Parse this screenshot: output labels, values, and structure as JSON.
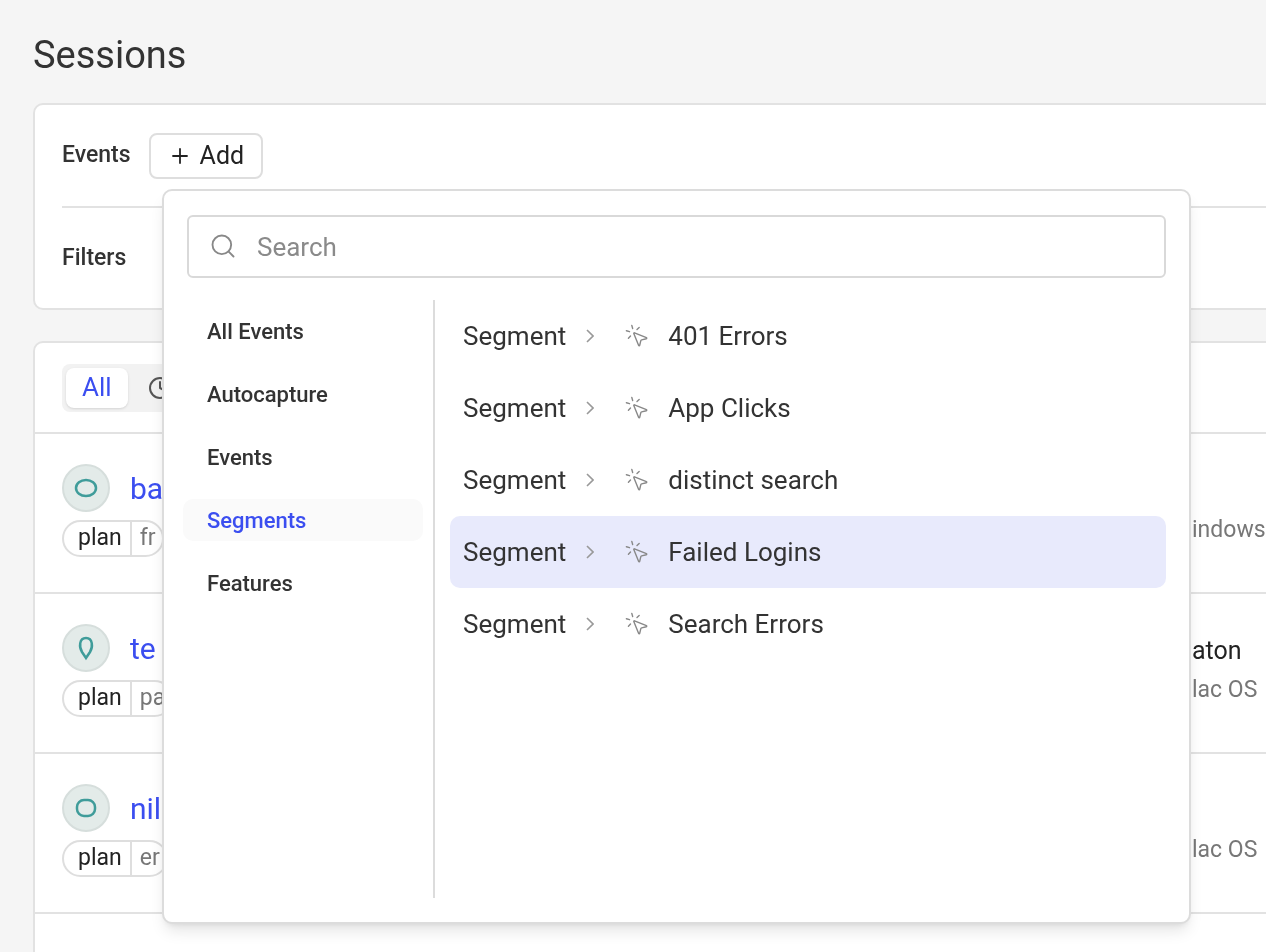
{
  "page": {
    "title": "Sessions"
  },
  "query_card": {
    "events_label": "Events",
    "add_button": "Add",
    "filters_label": "Filters"
  },
  "sessions": {
    "tabs": [
      {
        "label": "All",
        "selected": true
      },
      {
        "kind": "icon",
        "selected": false
      }
    ],
    "rows": [
      {
        "name": "ba",
        "tag_key": "plan",
        "tag_value": "fr",
        "os": "indows"
      },
      {
        "name": "te",
        "tag_key": "plan",
        "tag_value": "pa",
        "detail": "aton",
        "os": "lac OS"
      },
      {
        "name": "nil",
        "tag_key": "plan",
        "tag_value": "er",
        "os": "lac OS"
      }
    ]
  },
  "event_picker": {
    "search": {
      "placeholder": "Search"
    },
    "categories": [
      {
        "label": "All Events",
        "selected": false
      },
      {
        "label": "Autocapture",
        "selected": false
      },
      {
        "label": "Events",
        "selected": false
      },
      {
        "label": "Segments",
        "selected": true
      },
      {
        "label": "Features",
        "selected": false
      }
    ],
    "results": [
      {
        "category": "Segment",
        "name": "401 Errors",
        "selected": false
      },
      {
        "category": "Segment",
        "name": "App Clicks",
        "selected": false
      },
      {
        "category": "Segment",
        "name": "distinct search",
        "selected": false
      },
      {
        "category": "Segment",
        "name": "Failed Logins",
        "selected": true
      },
      {
        "category": "Segment",
        "name": "Search Errors",
        "selected": false
      }
    ]
  }
}
